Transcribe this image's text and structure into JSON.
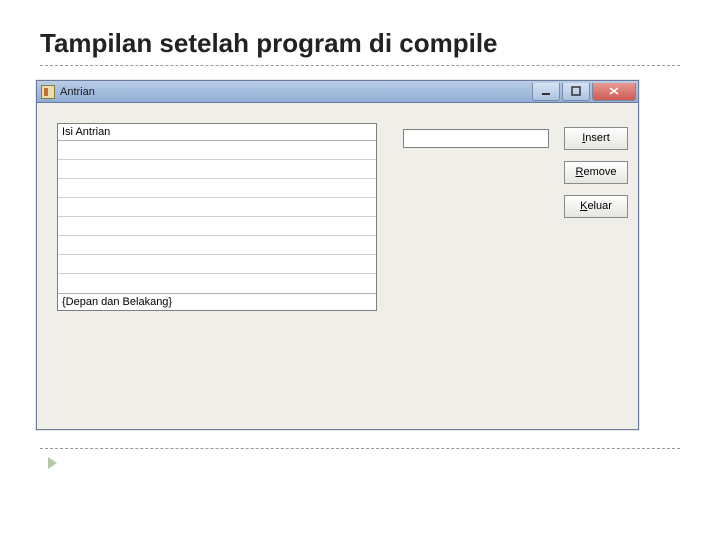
{
  "slide": {
    "title": "Tampilan setelah program di compile"
  },
  "window": {
    "title": "Antrian"
  },
  "grid": {
    "header": "Isi Antrian",
    "footer": "{Depan dan Belakang}",
    "row_count": 8
  },
  "input": {
    "value": ""
  },
  "buttons": {
    "insert": {
      "pre": "",
      "u": "I",
      "post": "nsert"
    },
    "remove": {
      "pre": "",
      "u": "R",
      "post": "emove"
    },
    "keluar": {
      "pre": "",
      "u": "K",
      "post": "eluar"
    }
  }
}
